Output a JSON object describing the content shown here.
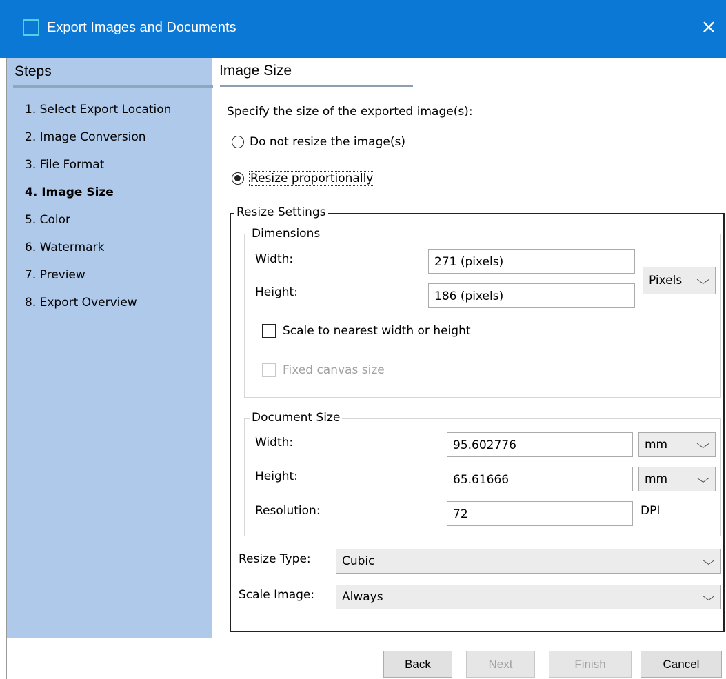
{
  "window": {
    "title": "Export Images and Documents",
    "close_icon": "×"
  },
  "sidebar": {
    "title": "Steps",
    "items": [
      {
        "label": "1. Select Export Location"
      },
      {
        "label": "2. Image Conversion"
      },
      {
        "label": "3. File Format"
      },
      {
        "label": "4. Image Size",
        "active": true
      },
      {
        "label": "5. Color"
      },
      {
        "label": "6. Watermark"
      },
      {
        "label": "7. Preview"
      },
      {
        "label": "8. Export Overview"
      }
    ]
  },
  "main": {
    "title": "Image Size",
    "instruction": "Specify the size of the exported image(s):",
    "radio_no_resize": "Do not resize the image(s)",
    "radio_resize_prop": "Resize proportionally",
    "resize_settings": {
      "label": "Resize Settings",
      "dimensions": {
        "label": "Dimensions",
        "width_label": "Width:",
        "width_value": "271 (pixels)",
        "height_label": "Height:",
        "height_value": "186 (pixels)",
        "unit": "Pixels",
        "scale_nearest": "Scale to nearest width or height",
        "fixed_canvas": "Fixed canvas size"
      },
      "document_size": {
        "label": "Document Size",
        "width_label": "Width:",
        "width_value": "95.602776",
        "width_unit": "mm",
        "height_label": "Height:",
        "height_value": "65.61666",
        "height_unit": "mm",
        "resolution_label": "Resolution:",
        "resolution_value": "72",
        "resolution_unit": "DPI"
      },
      "resize_type_label": "Resize Type:",
      "resize_type_value": "Cubic",
      "scale_image_label": "Scale Image:",
      "scale_image_value": "Always"
    }
  },
  "footer": {
    "back": "Back",
    "next": "Next",
    "finish": "Finish",
    "cancel": "Cancel"
  },
  "colors": {
    "titlebar": "#0a78d4",
    "sidebar": "#aec9ea"
  }
}
